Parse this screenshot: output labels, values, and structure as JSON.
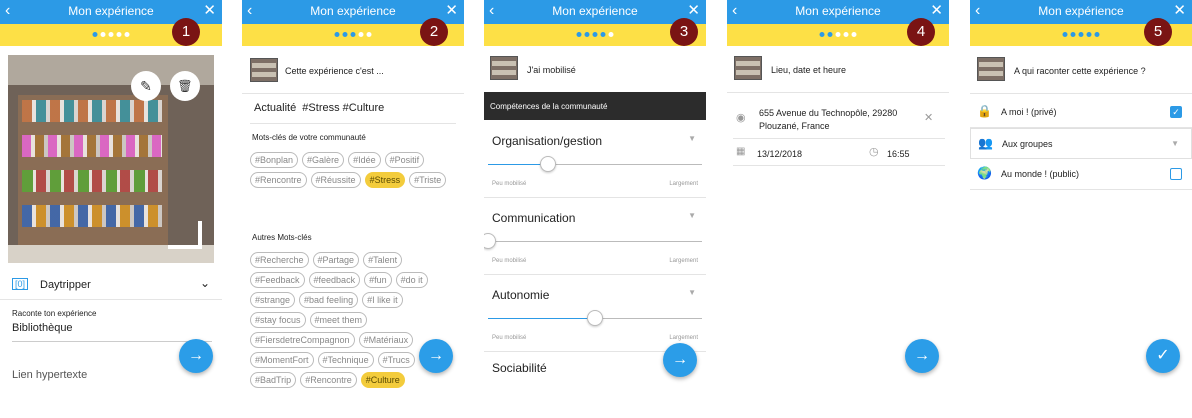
{
  "common": {
    "title": "Mon expérience",
    "back_icon": "chevron-left-icon",
    "close_icon": "close-icon"
  },
  "screens": [
    {
      "step": "1",
      "dots_active": 1,
      "app_name": "Daytripper",
      "story_label": "Raconte ton expérience",
      "story_value": "Bibliothèque",
      "link_label": "Lien hypertexte"
    },
    {
      "step": "2",
      "dots_active": 3,
      "header": "Cette expérience c'est ...",
      "summary": "Actualité  #Stress #Culture",
      "community_title": "Mots-clés de votre communauté",
      "community_tags": [
        "#Bonplan",
        "#Galère",
        "#Idée",
        "#Positif",
        "#Rencontre",
        "#Réussite",
        "#Stress",
        "#Triste"
      ],
      "other_title": "Autres Mots-clés",
      "other_tags": [
        "#Recherche",
        "#Partage",
        "#Talent",
        "#Feedback",
        "#feedback",
        "#fun",
        "#do it",
        "#strange",
        "#bad feeling",
        "#I like it",
        "#stay focus",
        "#meet them",
        "#FiersdetreCompagnon",
        "#Matériaux",
        "#MomentFort",
        "#Technique",
        "#Trucs",
        "#BadTrip",
        "#Rencontre",
        "#Culture"
      ],
      "selected_tags": [
        "#Stress",
        "#Culture"
      ]
    },
    {
      "step": "3",
      "dots_active": 4,
      "header": "J'ai mobilisé",
      "section": "Compétences de la communauté",
      "min_label": "Peu mobilisé",
      "max_label": "Largement",
      "competences": [
        {
          "name": "Organisation/gestion",
          "level": 0.28
        },
        {
          "name": "Communication",
          "level": 0.0
        },
        {
          "name": "Autonomie",
          "level": 0.5
        },
        {
          "name": "Sociabilité",
          "level": null
        }
      ]
    },
    {
      "step": "4",
      "dots_active": 2,
      "header": "Lieu, date et heure",
      "address_line1": "655 Avenue du Technopôle, 29280",
      "address_line2": "Plouzané, France",
      "date": "13/12/2018",
      "time": "16:55"
    },
    {
      "step": "5",
      "dots_active": 5,
      "header": "A qui raconter cette expérience ?",
      "options": [
        {
          "label": "A moi ! (privé)",
          "icon": "lock-icon",
          "control": "checkbox",
          "checked": true
        },
        {
          "label": "Aux groupes",
          "icon": "group-icon",
          "control": "dropdown",
          "checked": false
        },
        {
          "label": "Au monde ! (public)",
          "icon": "globe-icon",
          "control": "checkbox",
          "checked": false
        }
      ]
    }
  ],
  "colors": {
    "primary": "#2c9ae6",
    "yellow": "#fde046",
    "badge": "#7a1414",
    "tag_selected": "#f3cc3c"
  }
}
